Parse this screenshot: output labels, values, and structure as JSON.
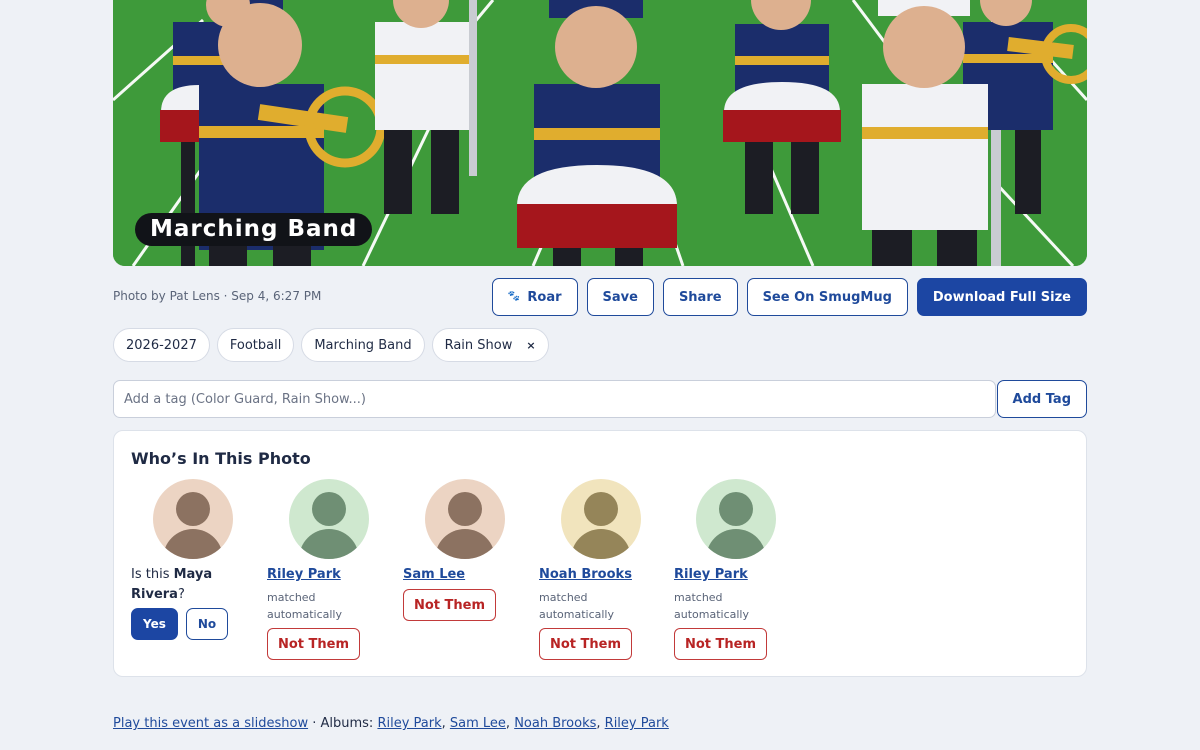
{
  "photo": {
    "caption": "Marching Band",
    "colors": {
      "field": "#3e9a3a",
      "navy": "#1b2d6b",
      "gold": "#e0ad2e",
      "red": "#a5161c",
      "skin": "#ddb08f"
    }
  },
  "meta": {
    "credit": "Photo by Pat Lens · Sep 4, 6:27 PM"
  },
  "actions": {
    "roar": "Roar",
    "save": "Save",
    "share": "Share",
    "smugmug": "See On SmugMug",
    "download": "Download Full Size"
  },
  "tags": {
    "items": [
      "2026-2027",
      "Football",
      "Marching Band",
      "Rain Show"
    ],
    "remove_glyph": "×",
    "input_placeholder": "Add a tag (Color Guard, Rain Show...)",
    "add_label": "Add Tag"
  },
  "people": {
    "title": "Who’s In This Photo",
    "prompt": {
      "prefix": "Is this ",
      "name": "Maya Rivera",
      "suffix": "?",
      "yes": "Yes",
      "no": "No",
      "avatar_bg": "#ecd4c3"
    },
    "matched_text": "matched automatically",
    "not_them": "Not Them",
    "list": [
      {
        "name": "Riley Park",
        "matched": true,
        "avatar_bg": "#cfe8cf"
      },
      {
        "name": "Sam Lee",
        "matched": false,
        "avatar_bg": "#ecd4c3"
      },
      {
        "name": "Noah Brooks",
        "matched": true,
        "avatar_bg": "#f1e4bd"
      },
      {
        "name": "Riley Park",
        "matched": true,
        "avatar_bg": "#cfe8cf"
      }
    ]
  },
  "footer": {
    "slideshow": "Play this event as a slideshow",
    "separator": " · ",
    "albums_label": "Albums: ",
    "albums": [
      "Riley Park",
      "Sam Lee",
      "Noah Brooks",
      "Riley Park"
    ]
  }
}
